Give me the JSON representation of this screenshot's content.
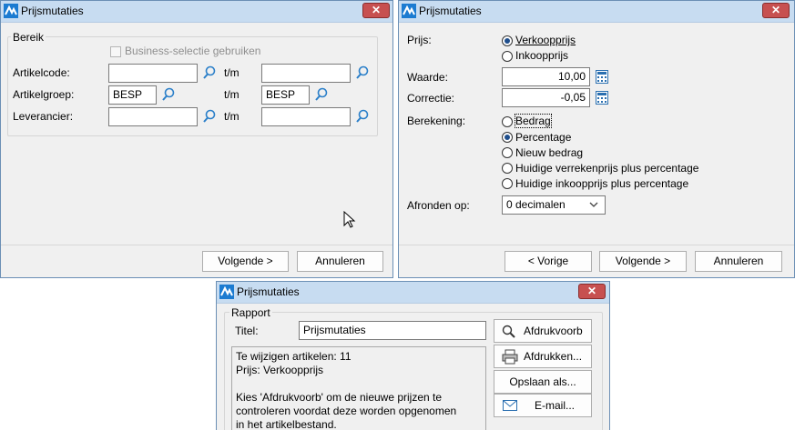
{
  "app_title": "Prijsmutaties",
  "close_glyph": "✕",
  "dlg1": {
    "group_title": "Bereik",
    "business_checkbox_label": "Business-selectie gebruiken",
    "tm_label": "t/m",
    "rows": [
      {
        "label": "Artikelcode:",
        "from": "",
        "to": ""
      },
      {
        "label": "Artikelgroep:",
        "from": "BESP",
        "to": "BESP"
      },
      {
        "label": "Leverancier:",
        "from": "",
        "to": ""
      }
    ],
    "next_button": "Volgende >",
    "cancel_button": "Annuleren"
  },
  "dlg2": {
    "prijs_label": "Prijs:",
    "prijs_options": [
      "Verkoopprijs",
      "Inkoopprijs"
    ],
    "prijs_selected": 0,
    "waarde_label": "Waarde:",
    "waarde_value": "10,00",
    "correctie_label": "Correctie:",
    "correctie_value": "-0,05",
    "berekening_label": "Berekening:",
    "berekening_options": [
      "Bedrag",
      "Percentage",
      "Nieuw bedrag",
      "Huidige verrekenprijs plus percentage",
      "Huidige inkoopprijs plus percentage"
    ],
    "berekening_selected": 1,
    "afronden_label": "Afronden op:",
    "afronden_value": "0 decimalen",
    "prev_button": "< Vorige",
    "next_button": "Volgende >",
    "cancel_button": "Annuleren"
  },
  "dlg3": {
    "group_title": "Rapport",
    "titel_label": "Titel:",
    "titel_value": "Prijsmutaties",
    "info_lines": [
      "Te wijzigen artikelen: 11",
      "Prijs: Verkoopprijs",
      "",
      "Kies 'Afdrukvoorb' om de nieuwe prijzen te",
      "controleren voordat deze worden opgenomen",
      "in het artikelbestand."
    ],
    "preview_button": "Afdrukvoorb",
    "print_button": "Afdrukken...",
    "save_button": "Opslaan als...",
    "email_button": "E-mail..."
  }
}
